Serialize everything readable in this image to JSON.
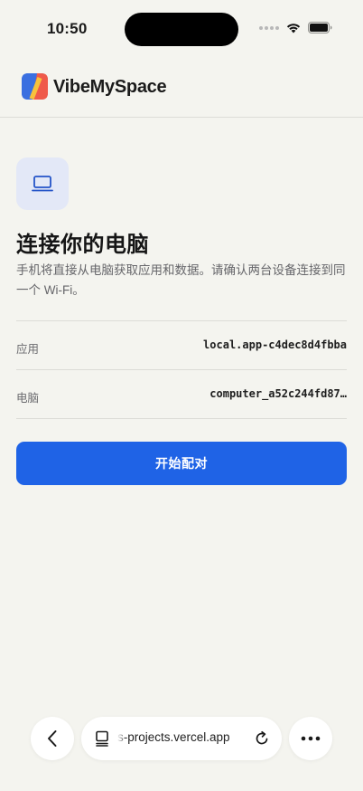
{
  "status_bar": {
    "time": "10:50"
  },
  "header": {
    "brand": "VibeMySpace"
  },
  "pairing": {
    "title": "连接你的电脑",
    "description": "手机将直接从电脑获取应用和数据。请确认两台设备连接到同一个 Wi-Fi。",
    "rows": [
      {
        "label": "应用",
        "value": "local.app-c4dec8d4fbba"
      },
      {
        "label": "电脑",
        "value": "computer_a52c244fd87…"
      }
    ],
    "start_button": "开始配对"
  },
  "browser": {
    "url": "s-projects.vercel.app"
  },
  "colors": {
    "accent": "#1f63e6",
    "background": "#f4f4ef",
    "icon_tile": "#e3e8f7"
  }
}
